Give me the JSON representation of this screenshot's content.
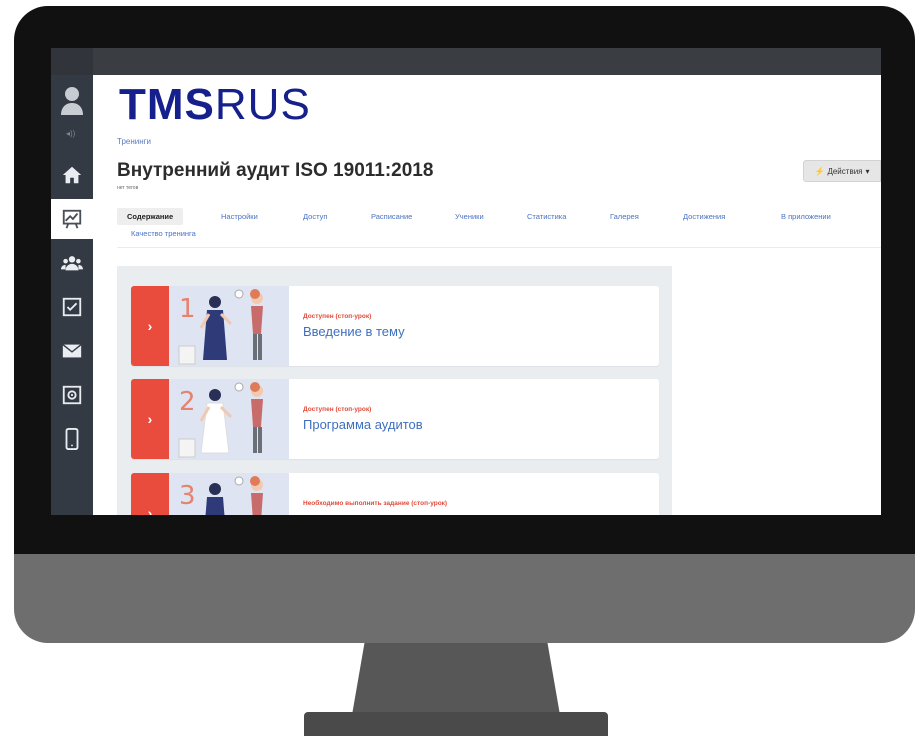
{
  "app": {
    "logo_main": "TMS",
    "logo_sub": "RUS",
    "breadcrumb": "Тренинги",
    "page_title": "Внутренний аудит ISO 19011:2018",
    "tags_text": "нет тегов",
    "actions_label": "Действия"
  },
  "sidebar": {
    "items": [
      {
        "icon": "home-icon"
      },
      {
        "icon": "training-chart-icon",
        "active": true
      },
      {
        "icon": "users-icon"
      },
      {
        "icon": "checkbox-icon"
      },
      {
        "icon": "mail-icon"
      },
      {
        "icon": "settings-safe-icon"
      },
      {
        "icon": "mobile-icon"
      }
    ]
  },
  "tabs": [
    {
      "label": "Содержание",
      "active": true
    },
    {
      "label": "Настройки"
    },
    {
      "label": "Доступ"
    },
    {
      "label": "Расписание"
    },
    {
      "label": "Ученики"
    },
    {
      "label": "Статистика"
    },
    {
      "label": "Галерея"
    },
    {
      "label": "Достижения"
    },
    {
      "label": "В приложении"
    },
    {
      "label": "Качество тренинга"
    }
  ],
  "lessons": [
    {
      "number": "1",
      "status": "Доступен (стоп-урок)",
      "title": "Введение в тему"
    },
    {
      "number": "2",
      "status": "Доступен (стоп-урок)",
      "title": "Программа аудитов"
    },
    {
      "number": "3",
      "status": "Необходимо выполнить задание (стоп-урок)",
      "title": ""
    }
  ],
  "colors": {
    "accent_red": "#e94b3c",
    "brand_blue": "#16208c",
    "link_blue": "#4a72c5"
  }
}
